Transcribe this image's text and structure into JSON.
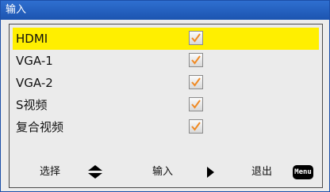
{
  "window": {
    "title": "输入"
  },
  "inputs": [
    {
      "label": "HDMI",
      "checked": true,
      "selected": true
    },
    {
      "label": "VGA-1",
      "checked": true,
      "selected": false
    },
    {
      "label": "VGA-2",
      "checked": true,
      "selected": false
    },
    {
      "label": "S视频",
      "checked": true,
      "selected": false
    },
    {
      "label": "复合视频",
      "checked": true,
      "selected": false
    }
  ],
  "footer": {
    "select_label": "选择",
    "input_label": "输入",
    "exit_label": "退出",
    "menu_key": "Menu"
  },
  "colors": {
    "title_bar": "#1c54b0",
    "selection": "#ffef00",
    "checkmark": "#f08a24"
  }
}
